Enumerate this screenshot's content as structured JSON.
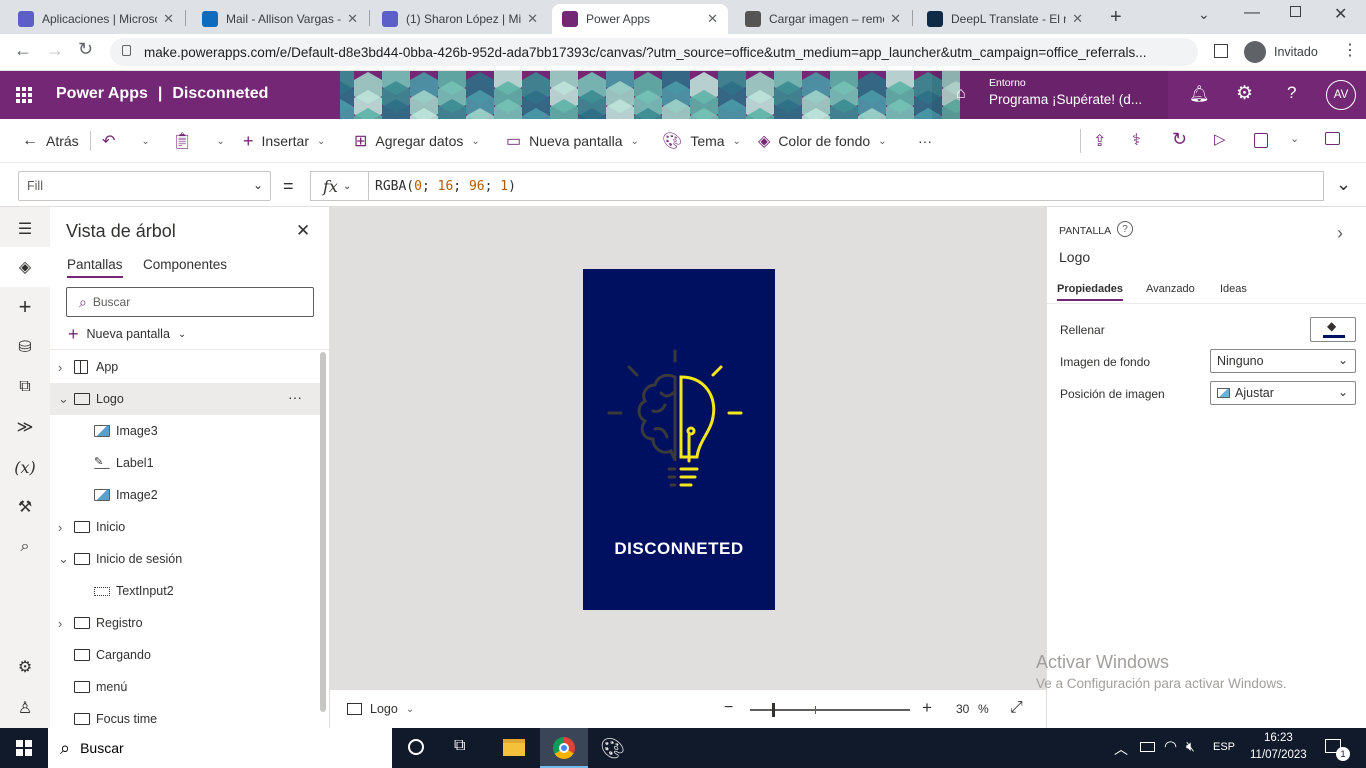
{
  "browser": {
    "tabs": [
      {
        "title": "Aplicaciones | Microso",
        "color": "#5b5fc7"
      },
      {
        "title": "Mail - Allison Vargas -",
        "color": "#0f6cbd"
      },
      {
        "title": "(1) Sharon López | Mic",
        "color": "#5b5fc7"
      },
      {
        "title": "Power Apps",
        "color": "#742774"
      },
      {
        "title": "Cargar imagen – remo",
        "color": "#555555"
      },
      {
        "title": "DeepL Translate - El m",
        "color": "#0f2b46"
      }
    ],
    "url": "make.powerapps.com/e/Default-d8e3bd44-0bba-426b-952d-ada7bb17393c/canvas/?utm_source=office&utm_medium=app_launcher&utm_campaign=office_referrals...",
    "profile": "Invitado"
  },
  "header": {
    "app_name": "Power Apps",
    "separator": "|",
    "project": "Disconneted",
    "env_label": "Entorno",
    "env_name": "Programa ¡Supérate! (d...",
    "avatar": "AV"
  },
  "toolbar": {
    "back": "Atrás",
    "insert": "Insertar",
    "add_data": "Agregar datos",
    "new_screen": "Nueva pantalla",
    "theme": "Tema",
    "bg_color": "Color de fondo",
    "more": "···"
  },
  "formula": {
    "property": "Fill",
    "equals": "=",
    "fx": "fx",
    "fn": "RGBA(",
    "args": [
      {
        "v": "0",
        "s": "; "
      },
      {
        "v": "16",
        "s": "; "
      },
      {
        "v": "96",
        "s": "; "
      },
      {
        "v": "1",
        "s": ""
      }
    ],
    "close": ")"
  },
  "tree": {
    "title": "Vista de árbol",
    "tab_screens": "Pantallas",
    "tab_components": "Componentes",
    "search_placeholder": "Buscar",
    "new_screen": "Nueva pantalla",
    "nodes": [
      {
        "label": "App",
        "level": 0,
        "chevron": "›",
        "icon": "app"
      },
      {
        "label": "Logo",
        "level": 0,
        "chevron": "⌄",
        "icon": "screen",
        "selected": true,
        "more": "···"
      },
      {
        "label": "Image3",
        "level": 1,
        "chevron": "",
        "icon": "image"
      },
      {
        "label": "Label1",
        "level": 1,
        "chevron": "",
        "icon": "label"
      },
      {
        "label": "Image2",
        "level": 1,
        "chevron": "",
        "icon": "image"
      },
      {
        "label": "Inicio",
        "level": 0,
        "chevron": "›",
        "icon": "screen"
      },
      {
        "label": "Inicio de sesión",
        "level": 0,
        "chevron": "⌄",
        "icon": "screen"
      },
      {
        "label": "TextInput2",
        "level": 1,
        "chevron": "",
        "icon": "input"
      },
      {
        "label": "Registro",
        "level": 0,
        "chevron": "›",
        "icon": "screen"
      },
      {
        "label": "Cargando",
        "level": 0,
        "chevron": "",
        "icon": "screen"
      },
      {
        "label": "menú",
        "level": 0,
        "chevron": "",
        "icon": "screen"
      },
      {
        "label": "Focus time",
        "level": 0,
        "chevron": "",
        "icon": "screen"
      }
    ]
  },
  "canvas": {
    "screen_bg": "#001060",
    "logo_text": "DISCONNETED",
    "bulb_color": "#f5e71a",
    "brain_color": "#3a3a3a"
  },
  "statusbar": {
    "screen": "Logo",
    "zoom": "30",
    "zoom_unit": "%"
  },
  "props": {
    "section": "PANTALLA",
    "name": "Logo",
    "tabs": [
      "Propiedades",
      "Avanzado",
      "Ideas"
    ],
    "fill_label": "Rellenar",
    "bgimage_label": "Imagen de fondo",
    "bgimage_value": "Ninguno",
    "imgpos_label": "Posición de imagen",
    "imgpos_value": "Ajustar",
    "watermark_title": "Activar Windows",
    "watermark_sub": "Ve a Configuración para activar Windows."
  },
  "taskbar": {
    "search": "Buscar",
    "lang": "ESP",
    "time": "16:23",
    "date": "11/07/2023",
    "notif_count": "1"
  },
  "colors": {
    "brand": "#742774",
    "accent": "#0f6cbd",
    "fill_swatch": "#001060"
  }
}
